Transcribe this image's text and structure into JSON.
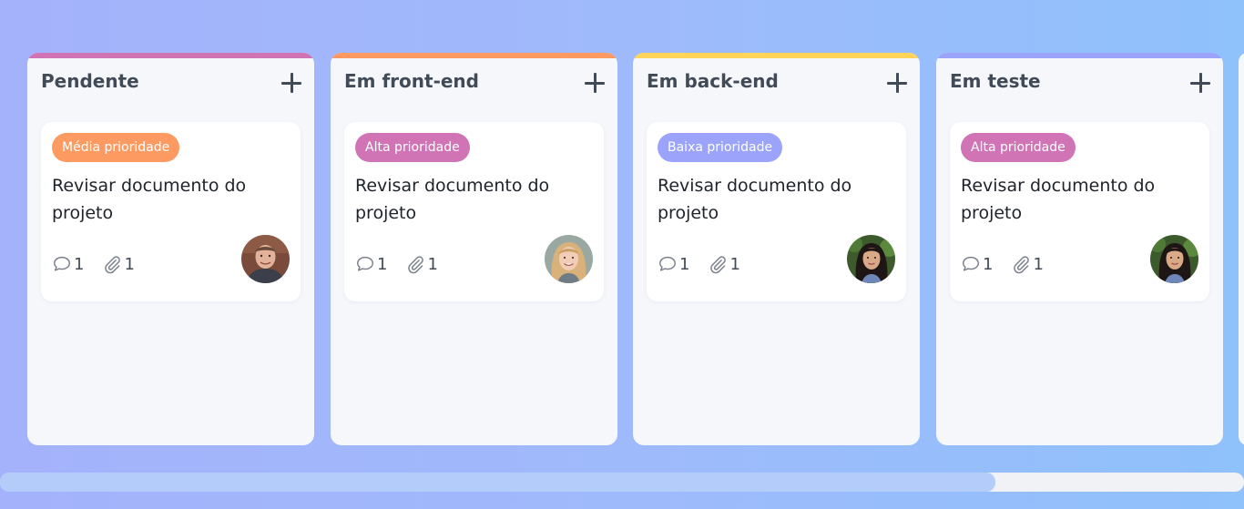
{
  "board": {
    "columns": [
      {
        "title": "Pendente",
        "color": "#d074b6",
        "card": {
          "tag": "Média prioridade",
          "tag_color": "#fd9a62",
          "title": "Revisar documento do projeto",
          "comments": "1",
          "attachments": "1",
          "avatar": "man-avatar"
        }
      },
      {
        "title": "Em front-end",
        "color": "#fd9a62",
        "card": {
          "tag": "Alta prioridade",
          "tag_color": "#d074b6",
          "title": "Revisar documento do projeto",
          "comments": "1",
          "attachments": "1",
          "avatar": "blonde-woman-avatar"
        }
      },
      {
        "title": "Em back-end",
        "color": "#fed55a",
        "card": {
          "tag": "Baixa prioridade",
          "tag_color": "#9ba4fa",
          "title": "Revisar documento do projeto",
          "comments": "1",
          "attachments": "1",
          "avatar": "dark-hair-woman-avatar"
        }
      },
      {
        "title": "Em teste",
        "color": "#9ba4fa",
        "card": {
          "tag": "Alta prioridade",
          "tag_color": "#d074b6",
          "title": "Revisar documento do projeto",
          "comments": "1",
          "attachments": "1",
          "avatar": "dark-hair-woman-avatar"
        }
      }
    ]
  },
  "scrollbar": {
    "thumb_fraction": 0.8
  },
  "icons": {
    "add": "plus-icon",
    "comments": "comment-icon",
    "attachments": "paperclip-icon"
  }
}
